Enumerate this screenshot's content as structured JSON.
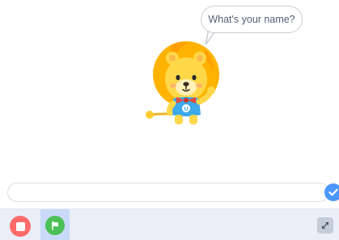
{
  "stage": {
    "speech_bubble_text": "What's your name?",
    "sprite_icon": "lion-sprite-icon"
  },
  "ask_prompt": {
    "answer_value": "",
    "submit_icon": "check-icon"
  },
  "controls": {
    "stop_icon": "stop-icon",
    "green_flag_icon": "green-flag-icon",
    "fullscreen_icon": "fullscreen-toggle-icon"
  },
  "colors": {
    "submit_blue": "#4c97ff",
    "stop_red": "#ff6b6b",
    "green_flag": "#4cbf56",
    "lion_mane": "#ffb300",
    "lion_face": "#ffd84a",
    "lion_shirt": "#3da9e8",
    "lion_bowtie": "#e8473a"
  }
}
